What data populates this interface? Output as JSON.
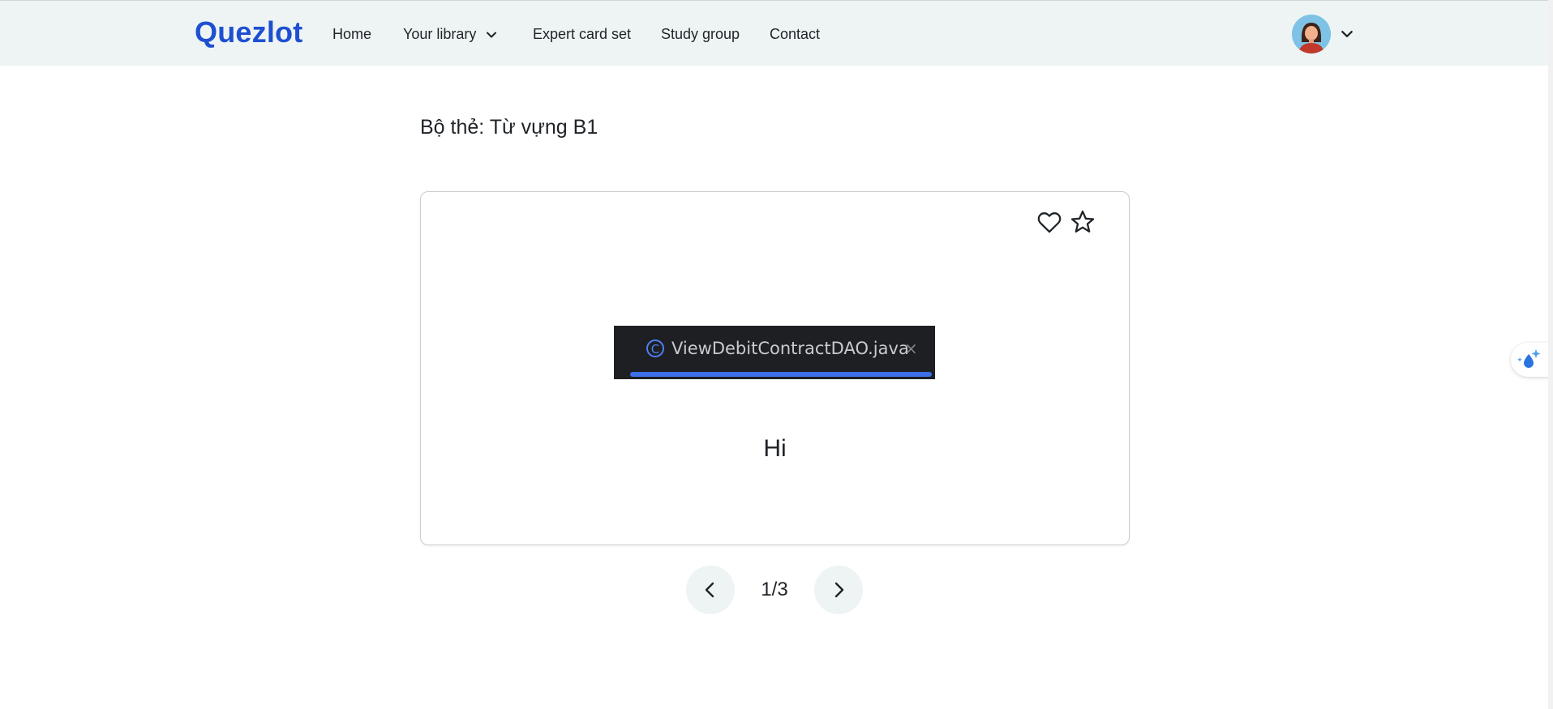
{
  "navbar": {
    "brand": "Quezlot",
    "items": [
      {
        "label": "Home"
      },
      {
        "label": "Your library"
      },
      {
        "label": "Expert card set"
      },
      {
        "label": "Study group"
      },
      {
        "label": "Contact"
      }
    ],
    "user_icon": "avatar-woman",
    "user_menu_icon": "chevron-down-icon"
  },
  "page": {
    "title": "Bộ thẻ: Từ vựng B1"
  },
  "card": {
    "favorite_icon": "heart-icon",
    "star_icon": "star-icon",
    "image_tab": {
      "file_name": "ViewDebitContractDAO.java",
      "class_glyph": "C",
      "close_glyph": "×"
    },
    "text": "Hi"
  },
  "pager": {
    "count": "1/3",
    "prev_icon": "chevron-left-icon",
    "next_icon": "chevron-right-icon"
  },
  "floating_widget": {
    "icon": "sparkle-drop-icon"
  },
  "colors": {
    "brand": "#1f4fd1",
    "nav_bg": "#eef4f4",
    "tab_bg": "#1e1f22",
    "tab_accent": "#3d6fe8"
  }
}
